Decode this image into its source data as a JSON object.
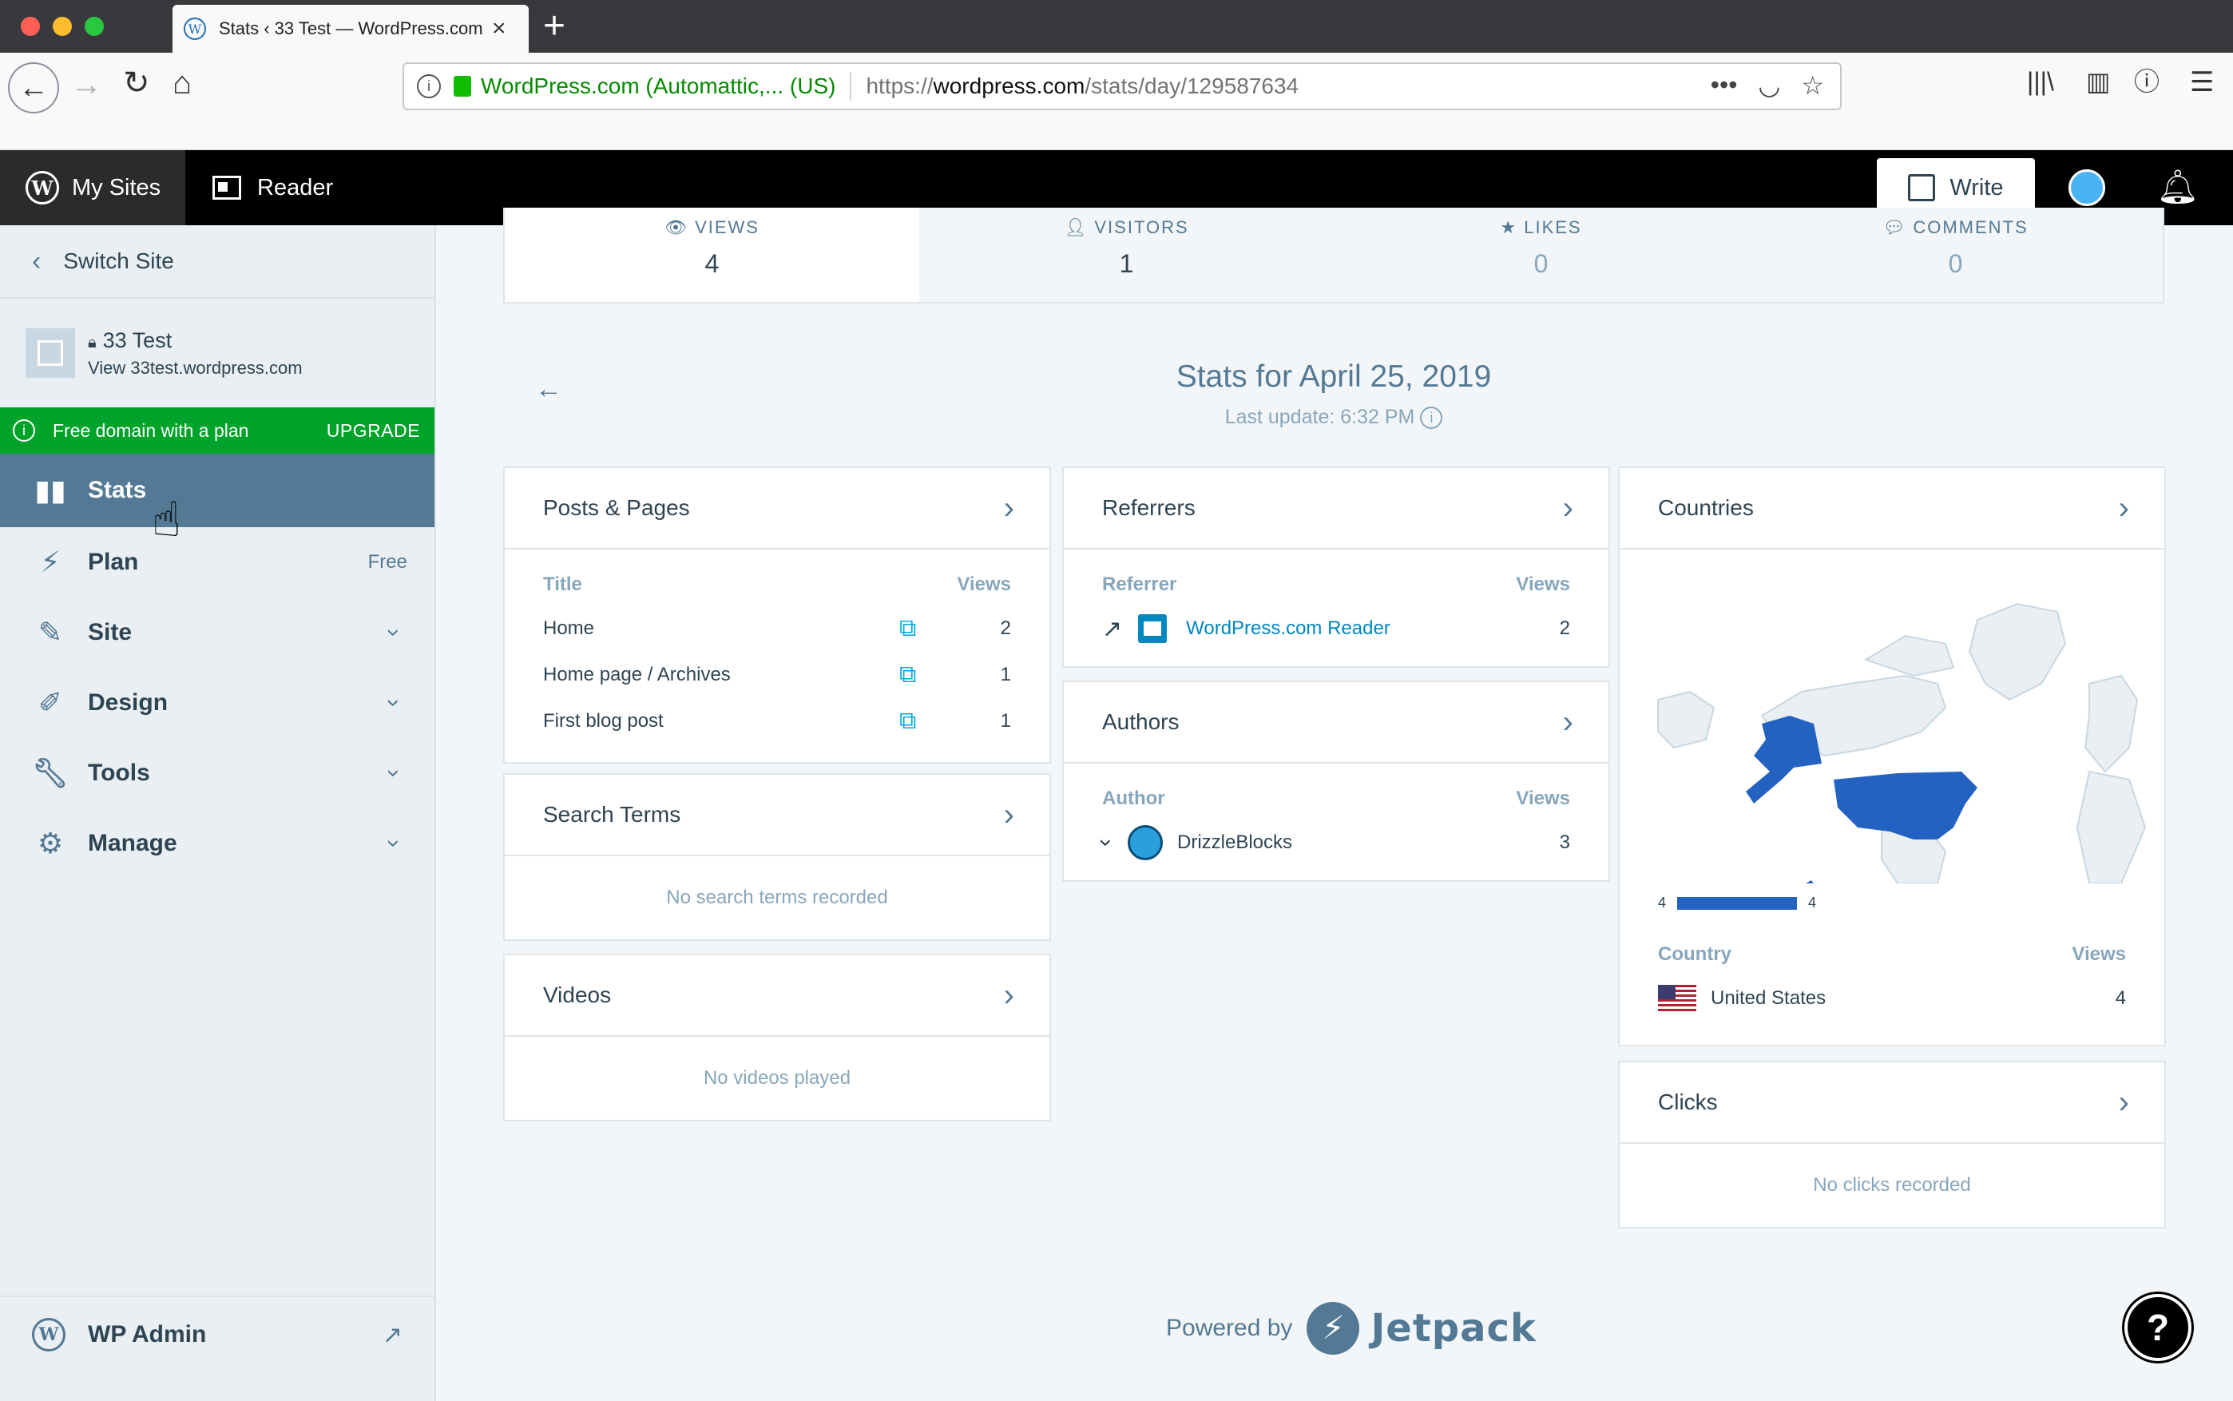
{
  "browser": {
    "tab_title": "Stats ‹ 33 Test — WordPress.com",
    "url_org": "WordPress.com (Automattic,...  (US)",
    "url_prefix": "https://",
    "url_host": "wordpress.com",
    "url_path": "/stats/day/129587634"
  },
  "masterbar": {
    "my_sites": "My Sites",
    "reader": "Reader",
    "write": "Write"
  },
  "sidebar": {
    "switch_site": "Switch Site",
    "site_name": "33 Test",
    "site_url": "View 33test.wordpress.com",
    "upsell_text": "Free domain with a plan",
    "upsell_cta": "UPGRADE",
    "items": [
      {
        "label": "Stats",
        "extra": ""
      },
      {
        "label": "Plan",
        "extra": "Free"
      },
      {
        "label": "Site",
        "extra": ""
      },
      {
        "label": "Design",
        "extra": ""
      },
      {
        "label": "Tools",
        "extra": ""
      },
      {
        "label": "Manage",
        "extra": ""
      }
    ],
    "wp_admin": "WP Admin"
  },
  "summary": [
    {
      "label": "VIEWS",
      "value": "4"
    },
    {
      "label": "VISITORS",
      "value": "1"
    },
    {
      "label": "LIKES",
      "value": "0"
    },
    {
      "label": "COMMENTS",
      "value": "0"
    }
  ],
  "date_header": {
    "title": "Stats for April 25, 2019",
    "subtitle": "Last update: 6:32 PM"
  },
  "posts_pages": {
    "title": "Posts & Pages",
    "col_title": "Title",
    "col_views": "Views",
    "rows": [
      {
        "title": "Home",
        "views": "2"
      },
      {
        "title": "Home page / Archives",
        "views": "1"
      },
      {
        "title": "First blog post",
        "views": "1"
      }
    ]
  },
  "search_terms": {
    "title": "Search Terms",
    "empty": "No search terms recorded"
  },
  "videos": {
    "title": "Videos",
    "empty": "No videos played"
  },
  "referrers": {
    "title": "Referrers",
    "col_ref": "Referrer",
    "col_views": "Views",
    "rows": [
      {
        "name": "WordPress.com Reader",
        "views": "2"
      }
    ]
  },
  "authors": {
    "title": "Authors",
    "col_author": "Author",
    "col_views": "Views",
    "rows": [
      {
        "name": "DrizzleBlocks",
        "views": "3"
      }
    ]
  },
  "countries": {
    "title": "Countries",
    "legend_min": "4",
    "legend_max": "4",
    "col_country": "Country",
    "col_views": "Views",
    "rows": [
      {
        "name": "United States",
        "views": "4"
      }
    ],
    "highlight_color": "#2462c1"
  },
  "clicks": {
    "title": "Clicks",
    "empty": "No clicks recorded"
  },
  "footer": {
    "powered_by": "Powered by",
    "brand": "Jetpack"
  },
  "colors": {
    "accent": "#537994",
    "upsell": "#00a32a",
    "link": "#0087be"
  }
}
